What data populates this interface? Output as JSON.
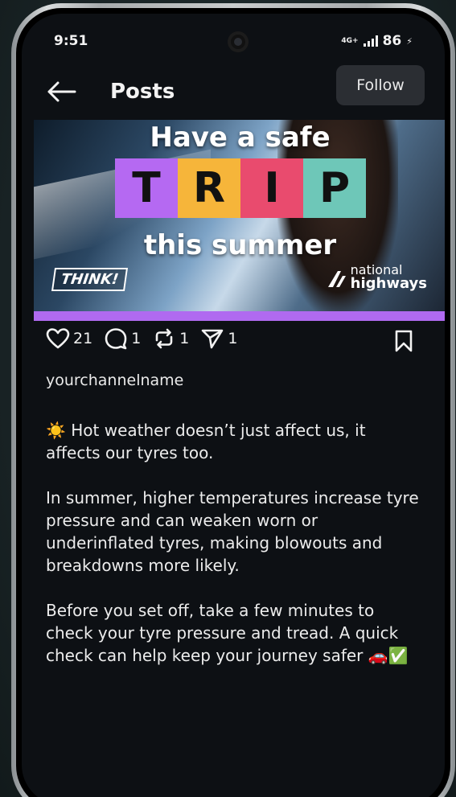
{
  "status_bar": {
    "time": "9:51",
    "network": "4G+",
    "battery": "86"
  },
  "header": {
    "title": "Posts",
    "follow_label": "Follow"
  },
  "post_image": {
    "line1": "Have a safe",
    "tiles": [
      {
        "letter": "T",
        "color": "#b569f2"
      },
      {
        "letter": "R",
        "color": "#f6b53a"
      },
      {
        "letter": "I",
        "color": "#e94b6e"
      },
      {
        "letter": "P",
        "color": "#6ec7b8"
      }
    ],
    "line2": "this summer",
    "left_logo": "THINK!",
    "right_logo_line1": "national",
    "right_logo_line2": "highways",
    "stripe_color": "#b06af0"
  },
  "actions": {
    "likes": "21",
    "comments": "1",
    "reposts": "1",
    "shares": "1"
  },
  "post": {
    "username": "yourchannelname",
    "paragraphs": [
      "☀️ Hot weather doesn’t just affect us, it affects our tyres too.",
      "In summer, higher temperatures increase tyre pressure and can weaken worn or underinflated tyres, making blowouts and breakdowns more likely.",
      "Before you set off, take a few minutes to check your tyre pressure and tread. A quick check can help keep your journey safer 🚗✅"
    ]
  }
}
